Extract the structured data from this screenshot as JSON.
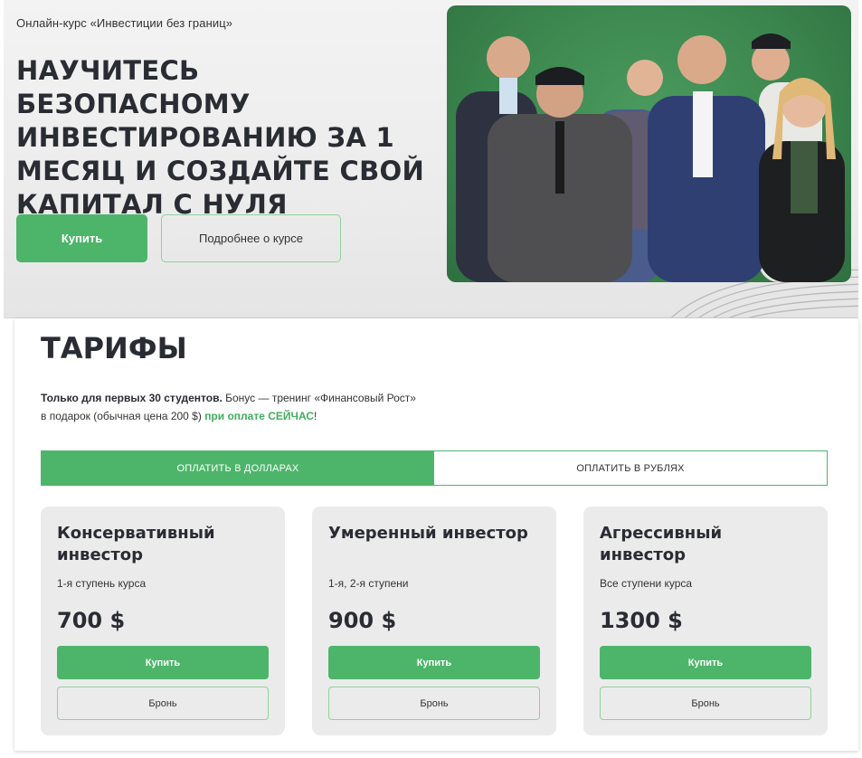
{
  "hero": {
    "subtitle": "Онлайн-курс «Инвестиции без границ»",
    "title": "НАУЧИТЕСЬ БЕЗОПАСНОМУ ИНВЕСТИРОВАНИЮ ЗА 1 МЕСЯЦ И СОЗДАЙТЕ СВОЙ КАПИТАЛ С НУЛЯ",
    "buy_label": "Купить",
    "more_label": "Подробнее о курсе",
    "photo_icon": "team-photo"
  },
  "tariffs": {
    "title": "ТАРИФЫ",
    "promo_bold": "Только для первых 30 студентов.",
    "promo_text1": " Бонус — тренинг «Финансовый Рост»",
    "promo_text2": "в подарок (обычная цена 200 $) ",
    "promo_green": "при оплате СЕЙЧАС",
    "promo_end": "!",
    "tabs": [
      {
        "label": "ОПЛАТИТЬ В ДОЛЛАРАХ",
        "active": true
      },
      {
        "label": "ОПЛАТИТЬ В РУБЛЯХ",
        "active": false
      }
    ],
    "plans": [
      {
        "name": "Консервативный инвестор",
        "desc": "1-я ступень курса",
        "price": "700 $",
        "buy": "Купить",
        "reserve": "Бронь"
      },
      {
        "name": "Умеренный инвестор",
        "desc": "1-я, 2-я ступени",
        "price": "900 $",
        "buy": "Купить",
        "reserve": "Бронь"
      },
      {
        "name": "Агрессивный инвестор",
        "desc": "Все ступени курса",
        "price": "1300 $",
        "buy": "Купить",
        "reserve": "Бронь"
      }
    ]
  },
  "colors": {
    "accent": "#4db56a",
    "text": "#2a2c33",
    "card_bg": "#ebebeb"
  }
}
